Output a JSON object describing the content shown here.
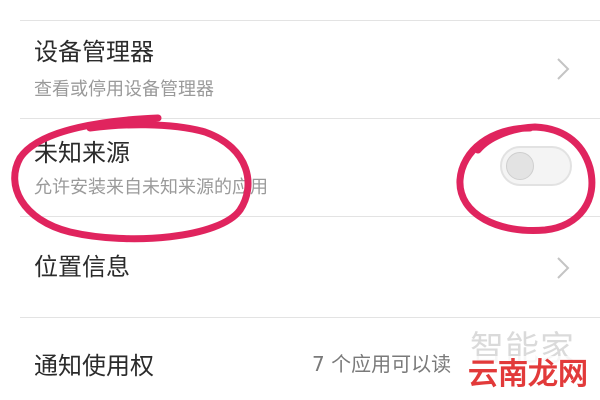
{
  "settings": {
    "items": [
      {
        "title": "设备管理器",
        "subtitle": "查看或停用设备管理器",
        "control": "chevron"
      },
      {
        "title": "未知来源",
        "subtitle": "允许安装来自未知来源的应用",
        "control": "toggle",
        "toggle_on": false
      },
      {
        "title": "位置信息",
        "subtitle": "",
        "control": "chevron"
      },
      {
        "title": "通知使用权",
        "value": "7 个应用可以读",
        "control": "chevron"
      }
    ]
  },
  "annotation": {
    "color": "#e0245e",
    "shape": "hand-drawn circles around 未知来源 item and its toggle"
  },
  "watermark": {
    "line1": "智能家",
    "line2": "云南龙网"
  },
  "colors": {
    "title_text": "#2b2b2b",
    "subtitle_text": "#9a9a9a",
    "divider": "#e3e3e3",
    "annotation": "#e0245e",
    "watermark_red": "#e23a3a"
  }
}
